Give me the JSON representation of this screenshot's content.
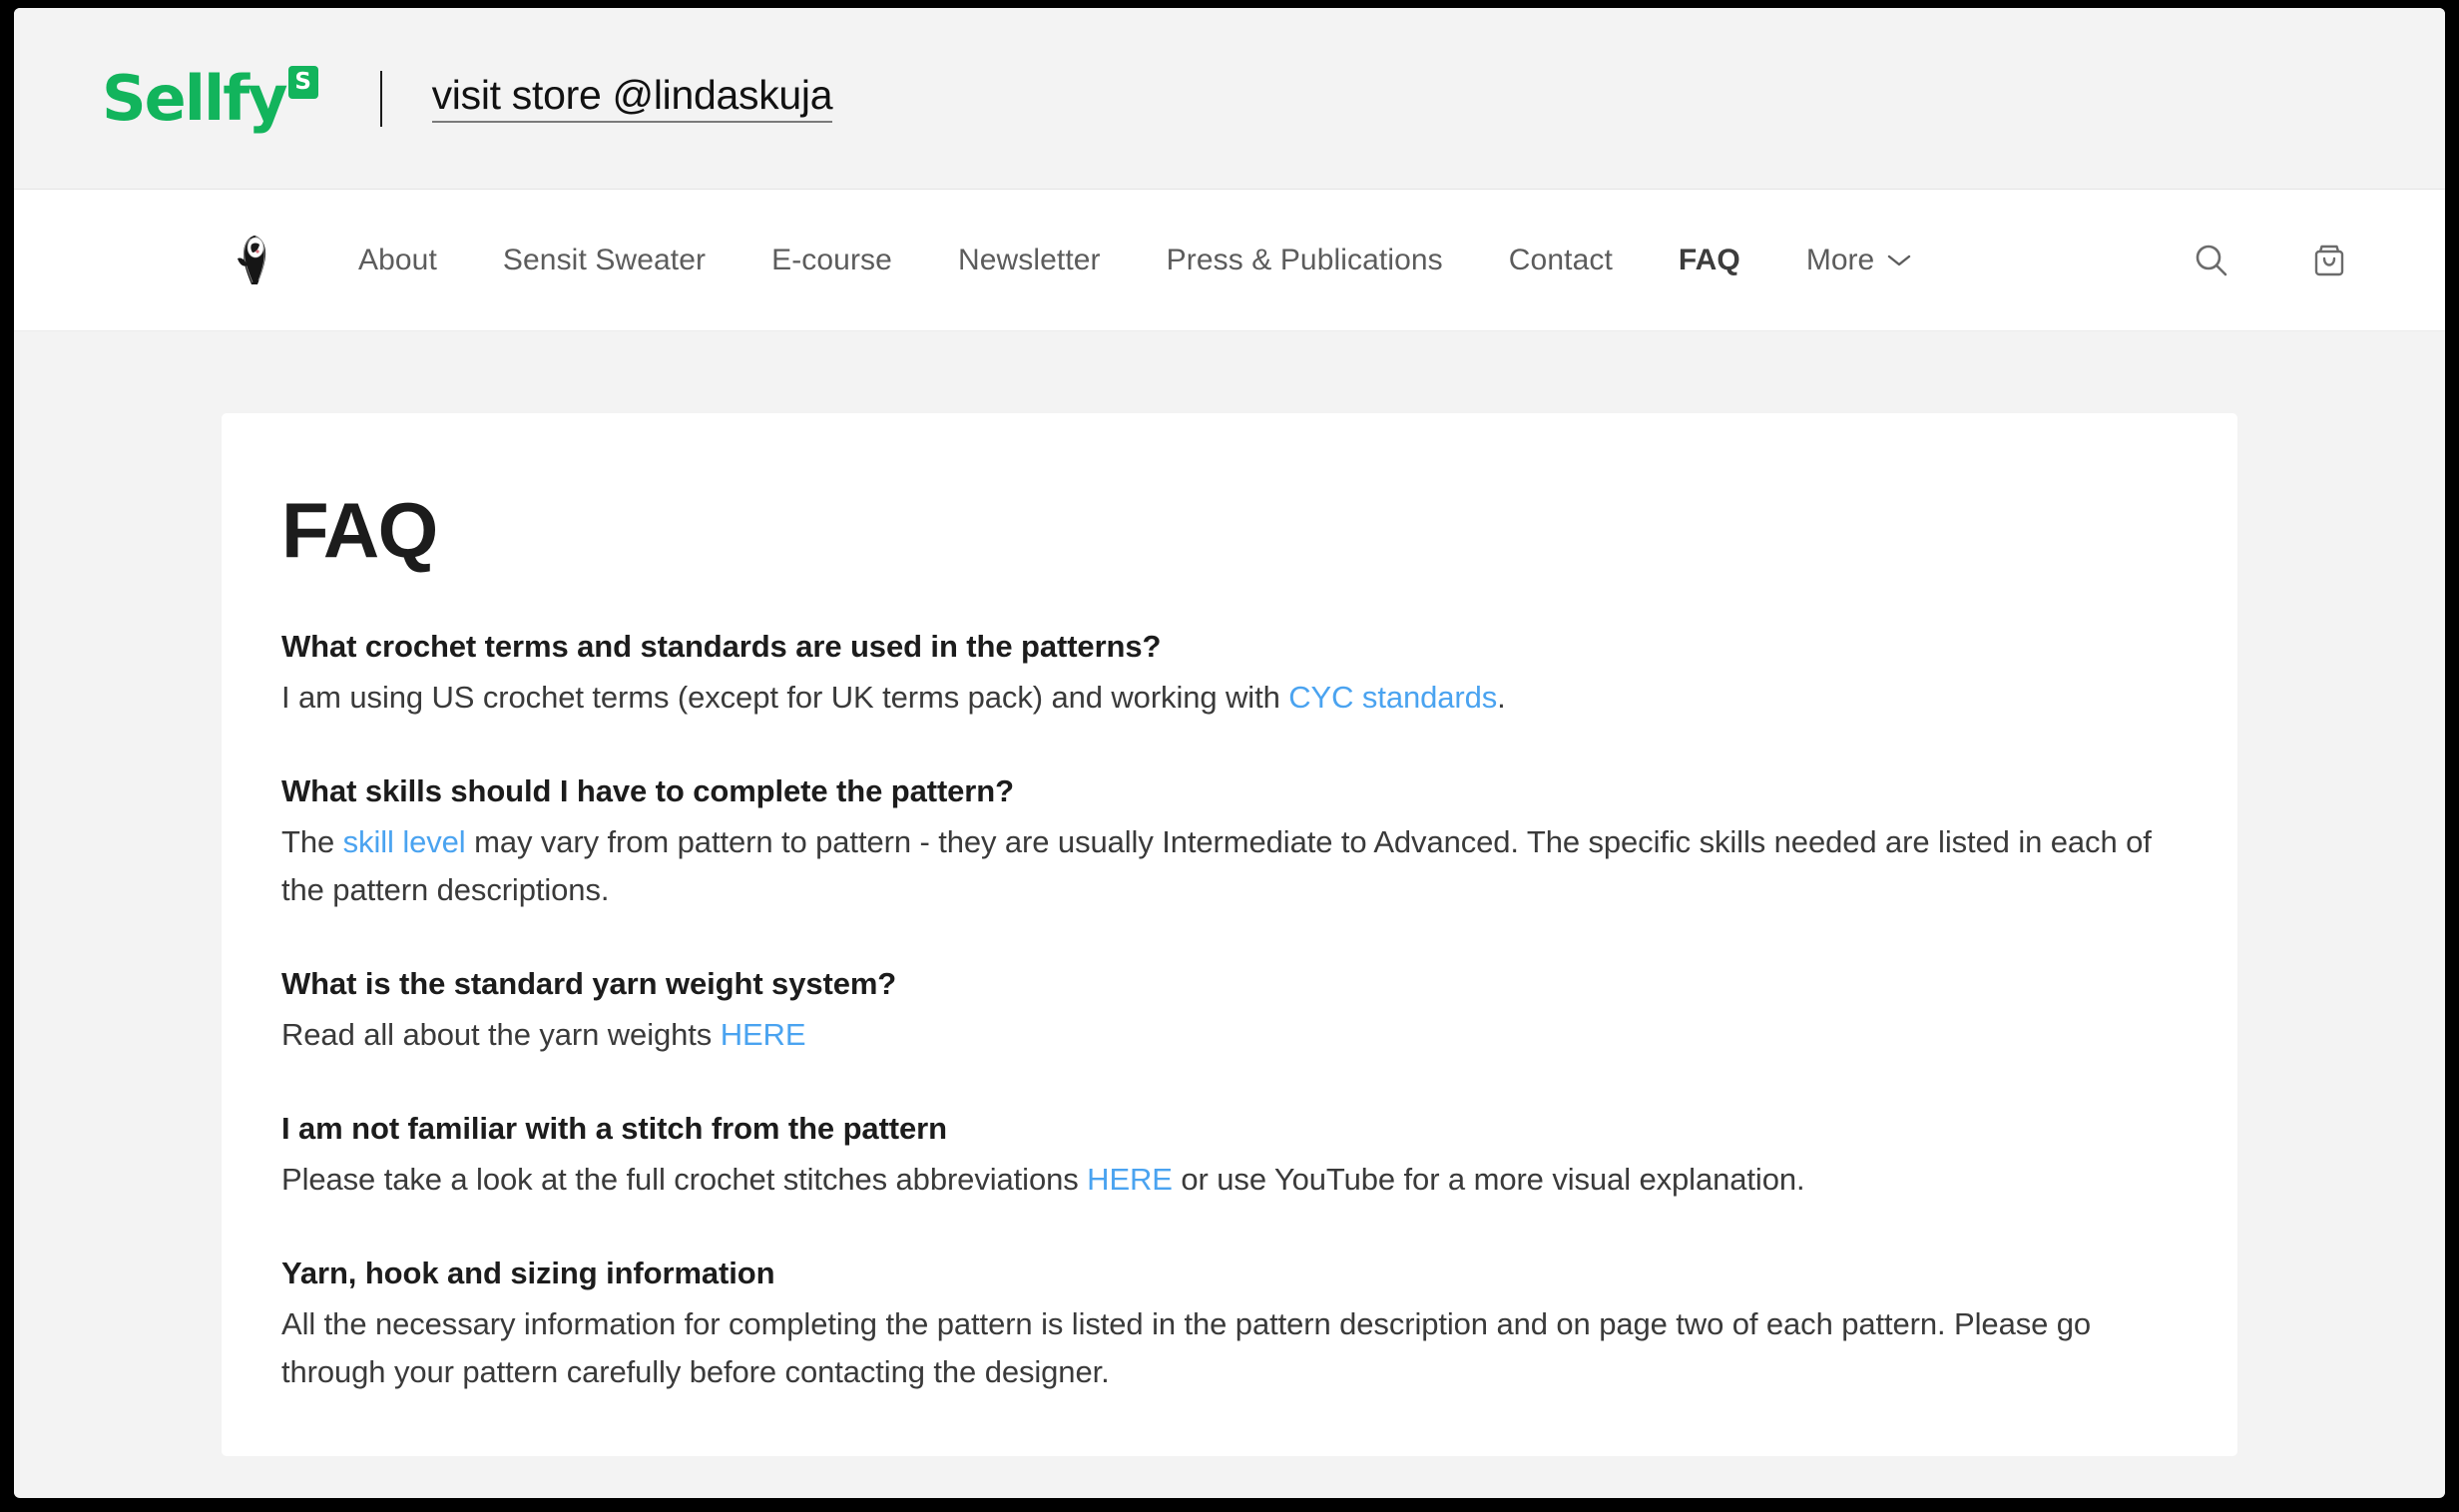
{
  "sellfy_bar": {
    "logo_word": "Sellfy",
    "logo_badge": "S",
    "visit_store_label": "visit store @lindaskuja"
  },
  "site_nav": {
    "brand_icon": "store-avatar-icon",
    "links": [
      {
        "label": "About",
        "active": false
      },
      {
        "label": "Sensit Sweater",
        "active": false
      },
      {
        "label": "E-course",
        "active": false
      },
      {
        "label": "Newsletter",
        "active": false
      },
      {
        "label": "Press & Publications",
        "active": false
      },
      {
        "label": "Contact",
        "active": false
      },
      {
        "label": "FAQ",
        "active": true
      }
    ],
    "more_label": "More",
    "more_icon": "chevron-down-icon",
    "search_icon": "search-icon",
    "cart_icon": "shopping-bag-icon"
  },
  "faq": {
    "title": "FAQ",
    "items": [
      {
        "question": "What crochet terms and standards are used in the patterns?",
        "answer_parts": [
          {
            "type": "text",
            "text": "I am using US crochet terms (except for UK terms pack) and working with "
          },
          {
            "type": "link",
            "text": "CYC standards"
          },
          {
            "type": "text",
            "text": "."
          }
        ]
      },
      {
        "question": "What skills should I have to complete the pattern?",
        "answer_parts": [
          {
            "type": "text",
            "text": "The "
          },
          {
            "type": "link",
            "text": "skill level"
          },
          {
            "type": "text",
            "text": " may vary from pattern to pattern - they are usually Intermediate to Advanced. The specific skills needed are listed in each of the pattern descriptions."
          }
        ]
      },
      {
        "question": "What is the standard yarn weight system?",
        "answer_parts": [
          {
            "type": "text",
            "text": "Read all about the yarn weights "
          },
          {
            "type": "link",
            "text": "HERE"
          }
        ]
      },
      {
        "question": "I am not familiar with a stitch from the pattern",
        "answer_parts": [
          {
            "type": "text",
            "text": "Please take a look at the full crochet stitches abbreviations "
          },
          {
            "type": "link",
            "text": "HERE"
          },
          {
            "type": "text",
            "text": " or use YouTube for a more visual explanation."
          }
        ]
      },
      {
        "question": "Yarn, hook and sizing information",
        "answer_parts": [
          {
            "type": "text",
            "text": "All the necessary information for completing the pattern is listed in the pattern description and on page two of each pattern. Please go through your pattern carefully before contacting the designer."
          }
        ]
      }
    ]
  },
  "colors": {
    "sellfy_green": "#12b45c",
    "link_blue": "#4aa3f0",
    "page_bg": "#f3f3f3",
    "card_bg": "#ffffff",
    "nav_text": "#5c5c5c"
  }
}
